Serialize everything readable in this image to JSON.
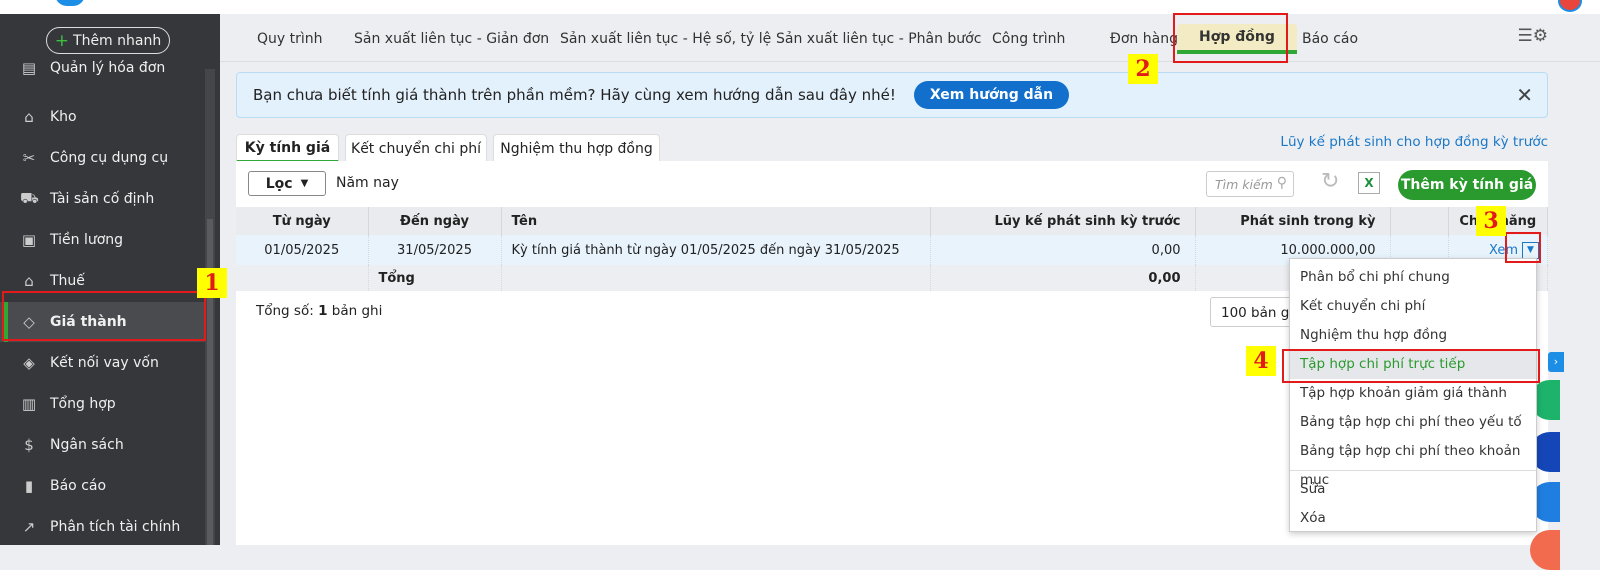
{
  "sidebar": {
    "quick_add": "Thêm nhanh",
    "items": [
      {
        "label": "Quản lý hóa đơn",
        "icon": "invoice-icon"
      },
      {
        "label": "Kho",
        "icon": "warehouse-icon"
      },
      {
        "label": "Công cụ dụng cụ",
        "icon": "tools-icon"
      },
      {
        "label": "Tài sản cố định",
        "icon": "car-icon"
      },
      {
        "label": "Tiền lương",
        "icon": "salary-icon"
      },
      {
        "label": "Thuế",
        "icon": "tax-icon"
      },
      {
        "label": "Giá thành",
        "icon": "tag-icon"
      },
      {
        "label": "Kết nối vay vốn",
        "icon": "loan-icon"
      },
      {
        "label": "Tổng hợp",
        "icon": "ledger-icon"
      },
      {
        "label": "Ngân sách",
        "icon": "budget-icon"
      },
      {
        "label": "Báo cáo",
        "icon": "bar-chart-icon"
      },
      {
        "label": "Phân tích tài chính",
        "icon": "line-chart-icon"
      }
    ]
  },
  "tabs": [
    "Quy trình",
    "Sản xuất liên tục - Giản đơn",
    "Sản xuất liên tục - Hệ số, tỷ lệ",
    "Sản xuất liên tục - Phân bước",
    "Công trình",
    "Đơn hàng",
    "Hợp đồng",
    "Báo cáo"
  ],
  "banner": {
    "text": "Bạn chưa biết tính giá thành trên phần mềm? Hãy cùng xem hướng dẫn sau đây nhé!",
    "button": "Xem hướng dẫn"
  },
  "subtabs": [
    "Kỳ tính giá",
    "Kết chuyển chi phí",
    "Nghiệm thu hợp đồng"
  ],
  "link": "Lũy kế phát sinh cho hợp đồng kỳ trước",
  "toolbar": {
    "filter": "Lọc",
    "period": "Năm nay",
    "search_placeholder": "Tìm kiếm",
    "add": "Thêm kỳ tính giá"
  },
  "table": {
    "headers": [
      "Từ ngày",
      "Đến ngày",
      "Tên",
      "Lũy kế phát sinh kỳ trước",
      "Phát sinh trong kỳ",
      "",
      "Chức năng"
    ],
    "row": {
      "from": "01/05/2025",
      "to": "31/05/2025",
      "name": "Kỳ tính giá thành từ ngày 01/05/2025 đến ngày 31/05/2025",
      "prior": "0,00",
      "current": "10.000.000,00",
      "action": "Xem"
    },
    "total": {
      "label": "Tổng",
      "prior": "0,00"
    }
  },
  "footer": {
    "count_prefix": "Tổng số: ",
    "count": "1",
    "count_suffix": " bản ghi",
    "page_size": "100 bản ghi"
  },
  "menu": [
    "Phân bổ chi phí chung",
    "Kết chuyển chi phí",
    "Nghiệm thu hợp đồng",
    "Tập hợp chi phí trực tiếp",
    "Tập hợp khoản giảm giá thành",
    "Bảng tập hợp chi phí theo yếu tố",
    "Bảng tập hợp chi phí theo khoản mục",
    "Sửa",
    "Xóa"
  ],
  "annotations": [
    "1",
    "2",
    "3",
    "4"
  ],
  "colors": {
    "accent": "#2a9a2f",
    "link": "#1a78c8",
    "annotation": "#e21a1a"
  }
}
